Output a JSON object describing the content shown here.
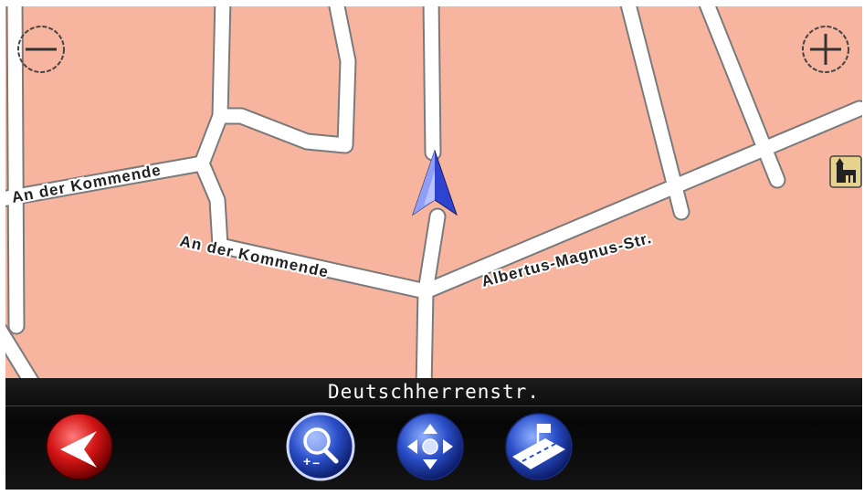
{
  "map": {
    "street_labels": [
      "An der Kommende",
      "An der Kommende",
      "Albertus-Magnus-Str."
    ],
    "background_color": "#f7b5a0",
    "road_color": "#ffffff",
    "position_marker_color": "#2e44d0",
    "icons": {
      "zoom_out": "zoom-out-icon",
      "zoom_in": "zoom-in-icon",
      "poi": "church-poi-icon",
      "position": "vehicle-position-arrow-icon"
    }
  },
  "bottom_bar": {
    "current_street": "Deutschherrenstr.",
    "buttons": [
      {
        "name": "back-button",
        "icon": "red-back-arrow-icon"
      },
      {
        "name": "zoom-tool-button",
        "icon": "magnifier-plus-minus-icon"
      },
      {
        "name": "pan-tool-button",
        "icon": "four-way-arrows-icon"
      },
      {
        "name": "route-tool-button",
        "icon": "road-flag-icon"
      }
    ]
  }
}
